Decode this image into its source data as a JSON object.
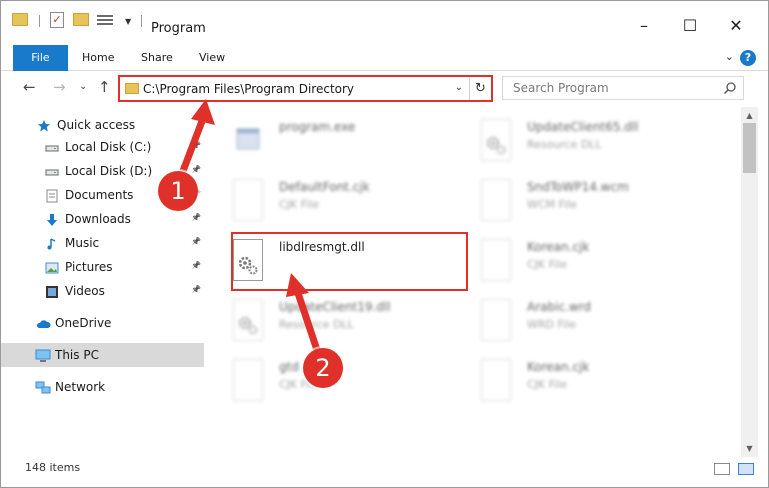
{
  "window": {
    "title": "Program",
    "controls": {
      "minimize": "–",
      "maximize": "☐",
      "close": "✕"
    }
  },
  "ribbon": {
    "tabs": [
      "File",
      "Home",
      "Share",
      "View"
    ],
    "help": "?",
    "collapse": "⌄"
  },
  "nav_buttons": {
    "back": "←",
    "forward": "→",
    "up_dropdown": "⌄",
    "up": "↑"
  },
  "address": {
    "path": "C:\\Program Files\\Program Directory",
    "dropdown": "⌄",
    "refresh": "↻"
  },
  "search": {
    "placeholder": "Search Program"
  },
  "sidebar": {
    "items": [
      {
        "label": "Quick access",
        "icon": "star-icon",
        "pinned": false
      },
      {
        "label": "Local Disk (C:)",
        "icon": "drive-icon",
        "pinned": true
      },
      {
        "label": "Local Disk (D:)",
        "icon": "drive-icon",
        "pinned": true
      },
      {
        "label": "Documents",
        "icon": "document-icon",
        "pinned": true
      },
      {
        "label": "Downloads",
        "icon": "download-icon",
        "pinned": true
      },
      {
        "label": "Music",
        "icon": "music-icon",
        "pinned": true
      },
      {
        "label": "Pictures",
        "icon": "picture-icon",
        "pinned": true
      },
      {
        "label": "Videos",
        "icon": "video-icon",
        "pinned": true
      },
      {
        "label": "OneDrive",
        "icon": "cloud-icon",
        "pinned": false
      },
      {
        "label": "This PC",
        "icon": "computer-icon",
        "pinned": false,
        "selected": true
      },
      {
        "label": "Network",
        "icon": "network-icon",
        "pinned": false
      }
    ]
  },
  "files": [
    {
      "name": "program.exe",
      "type": "",
      "icon": "exe-icon",
      "blurred": true
    },
    {
      "name": "UpdateClient65.dll",
      "type": "Resource DLL",
      "icon": "dll-icon",
      "blurred": true
    },
    {
      "name": "DefaultFont.cjk",
      "type": "CJK File",
      "icon": "file-icon",
      "blurred": true
    },
    {
      "name": "SndToWP14.wcm",
      "type": "WCM File",
      "icon": "file-icon",
      "blurred": true
    },
    {
      "name": "libdlresmgt.dll",
      "type": "",
      "icon": "dll-gear-icon",
      "blurred": false,
      "highlighted": true
    },
    {
      "name": "Korean.cjk",
      "type": "CJK File",
      "icon": "file-icon",
      "blurred": true
    },
    {
      "name": "UpdateClient19.dll",
      "type": "Resource DLL",
      "icon": "dll-icon",
      "blurred": true
    },
    {
      "name": "Arabic.wrd",
      "type": "WRD File",
      "icon": "file-icon",
      "blurred": true
    },
    {
      "name": "gtd",
      "type": "CJK File",
      "icon": "file-icon",
      "blurred": true
    },
    {
      "name": "Korean.cjk",
      "type": "CJK File",
      "icon": "file-icon",
      "blurred": true
    }
  ],
  "status": {
    "item_count": "148 items"
  },
  "callouts": [
    "1",
    "2"
  ],
  "colors": {
    "accent": "#1979ca",
    "annotation": "#e0302a",
    "selection": "#d9d9d9"
  }
}
